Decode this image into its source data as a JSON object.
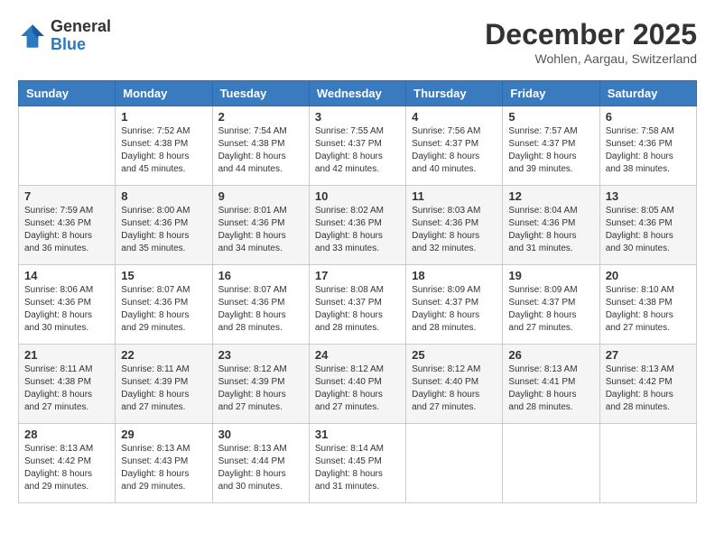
{
  "logo": {
    "general": "General",
    "blue": "Blue"
  },
  "header": {
    "month": "December 2025",
    "location": "Wohlen, Aargau, Switzerland"
  },
  "days_of_week": [
    "Sunday",
    "Monday",
    "Tuesday",
    "Wednesday",
    "Thursday",
    "Friday",
    "Saturday"
  ],
  "weeks": [
    [
      {
        "day": "",
        "info": ""
      },
      {
        "day": "1",
        "info": "Sunrise: 7:52 AM\nSunset: 4:38 PM\nDaylight: 8 hours\nand 45 minutes."
      },
      {
        "day": "2",
        "info": "Sunrise: 7:54 AM\nSunset: 4:38 PM\nDaylight: 8 hours\nand 44 minutes."
      },
      {
        "day": "3",
        "info": "Sunrise: 7:55 AM\nSunset: 4:37 PM\nDaylight: 8 hours\nand 42 minutes."
      },
      {
        "day": "4",
        "info": "Sunrise: 7:56 AM\nSunset: 4:37 PM\nDaylight: 8 hours\nand 40 minutes."
      },
      {
        "day": "5",
        "info": "Sunrise: 7:57 AM\nSunset: 4:37 PM\nDaylight: 8 hours\nand 39 minutes."
      },
      {
        "day": "6",
        "info": "Sunrise: 7:58 AM\nSunset: 4:36 PM\nDaylight: 8 hours\nand 38 minutes."
      }
    ],
    [
      {
        "day": "7",
        "info": "Sunrise: 7:59 AM\nSunset: 4:36 PM\nDaylight: 8 hours\nand 36 minutes."
      },
      {
        "day": "8",
        "info": "Sunrise: 8:00 AM\nSunset: 4:36 PM\nDaylight: 8 hours\nand 35 minutes."
      },
      {
        "day": "9",
        "info": "Sunrise: 8:01 AM\nSunset: 4:36 PM\nDaylight: 8 hours\nand 34 minutes."
      },
      {
        "day": "10",
        "info": "Sunrise: 8:02 AM\nSunset: 4:36 PM\nDaylight: 8 hours\nand 33 minutes."
      },
      {
        "day": "11",
        "info": "Sunrise: 8:03 AM\nSunset: 4:36 PM\nDaylight: 8 hours\nand 32 minutes."
      },
      {
        "day": "12",
        "info": "Sunrise: 8:04 AM\nSunset: 4:36 PM\nDaylight: 8 hours\nand 31 minutes."
      },
      {
        "day": "13",
        "info": "Sunrise: 8:05 AM\nSunset: 4:36 PM\nDaylight: 8 hours\nand 30 minutes."
      }
    ],
    [
      {
        "day": "14",
        "info": "Sunrise: 8:06 AM\nSunset: 4:36 PM\nDaylight: 8 hours\nand 30 minutes."
      },
      {
        "day": "15",
        "info": "Sunrise: 8:07 AM\nSunset: 4:36 PM\nDaylight: 8 hours\nand 29 minutes."
      },
      {
        "day": "16",
        "info": "Sunrise: 8:07 AM\nSunset: 4:36 PM\nDaylight: 8 hours\nand 28 minutes."
      },
      {
        "day": "17",
        "info": "Sunrise: 8:08 AM\nSunset: 4:37 PM\nDaylight: 8 hours\nand 28 minutes."
      },
      {
        "day": "18",
        "info": "Sunrise: 8:09 AM\nSunset: 4:37 PM\nDaylight: 8 hours\nand 28 minutes."
      },
      {
        "day": "19",
        "info": "Sunrise: 8:09 AM\nSunset: 4:37 PM\nDaylight: 8 hours\nand 27 minutes."
      },
      {
        "day": "20",
        "info": "Sunrise: 8:10 AM\nSunset: 4:38 PM\nDaylight: 8 hours\nand 27 minutes."
      }
    ],
    [
      {
        "day": "21",
        "info": "Sunrise: 8:11 AM\nSunset: 4:38 PM\nDaylight: 8 hours\nand 27 minutes."
      },
      {
        "day": "22",
        "info": "Sunrise: 8:11 AM\nSunset: 4:39 PM\nDaylight: 8 hours\nand 27 minutes."
      },
      {
        "day": "23",
        "info": "Sunrise: 8:12 AM\nSunset: 4:39 PM\nDaylight: 8 hours\nand 27 minutes."
      },
      {
        "day": "24",
        "info": "Sunrise: 8:12 AM\nSunset: 4:40 PM\nDaylight: 8 hours\nand 27 minutes."
      },
      {
        "day": "25",
        "info": "Sunrise: 8:12 AM\nSunset: 4:40 PM\nDaylight: 8 hours\nand 27 minutes."
      },
      {
        "day": "26",
        "info": "Sunrise: 8:13 AM\nSunset: 4:41 PM\nDaylight: 8 hours\nand 28 minutes."
      },
      {
        "day": "27",
        "info": "Sunrise: 8:13 AM\nSunset: 4:42 PM\nDaylight: 8 hours\nand 28 minutes."
      }
    ],
    [
      {
        "day": "28",
        "info": "Sunrise: 8:13 AM\nSunset: 4:42 PM\nDaylight: 8 hours\nand 29 minutes."
      },
      {
        "day": "29",
        "info": "Sunrise: 8:13 AM\nSunset: 4:43 PM\nDaylight: 8 hours\nand 29 minutes."
      },
      {
        "day": "30",
        "info": "Sunrise: 8:13 AM\nSunset: 4:44 PM\nDaylight: 8 hours\nand 30 minutes."
      },
      {
        "day": "31",
        "info": "Sunrise: 8:14 AM\nSunset: 4:45 PM\nDaylight: 8 hours\nand 31 minutes."
      },
      {
        "day": "",
        "info": ""
      },
      {
        "day": "",
        "info": ""
      },
      {
        "day": "",
        "info": ""
      }
    ]
  ]
}
